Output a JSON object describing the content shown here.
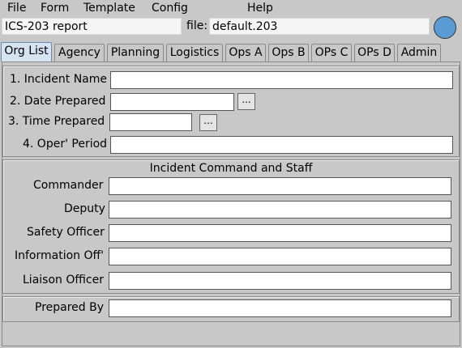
{
  "menu": {
    "file": "File",
    "form": "Form",
    "template": "Template",
    "config": "Config",
    "help": "Help"
  },
  "header": {
    "title_value": "ICS-203 report",
    "file_label": "file:",
    "file_value": "default.203",
    "status_color": "#5b9bd5"
  },
  "tabs": [
    {
      "label": "Org List",
      "active": true
    },
    {
      "label": "Agency"
    },
    {
      "label": "Planning"
    },
    {
      "label": "Logistics"
    },
    {
      "label": "Ops A"
    },
    {
      "label": "Ops B"
    },
    {
      "label": "OPs C"
    },
    {
      "label": "OPs D"
    },
    {
      "label": "Admin"
    }
  ],
  "incident": {
    "name_label": "1. Incident Name",
    "name_value": "",
    "date_label": "2. Date Prepared",
    "date_value": "",
    "date_button": "...",
    "time_label": "3. Time Prepared",
    "time_value": "",
    "time_button": "...",
    "period_label": "4. Oper' Period",
    "period_value": ""
  },
  "command": {
    "title": "Incident Command and Staff",
    "commander_label": "Commander",
    "commander_value": "",
    "deputy_label": "Deputy",
    "deputy_value": "",
    "safety_label": "Safety Officer",
    "safety_value": "",
    "info_label": "Information Off'",
    "info_value": "",
    "liaison_label": "Liaison Officer",
    "liaison_value": ""
  },
  "prepared": {
    "label": "Prepared By",
    "value": ""
  }
}
